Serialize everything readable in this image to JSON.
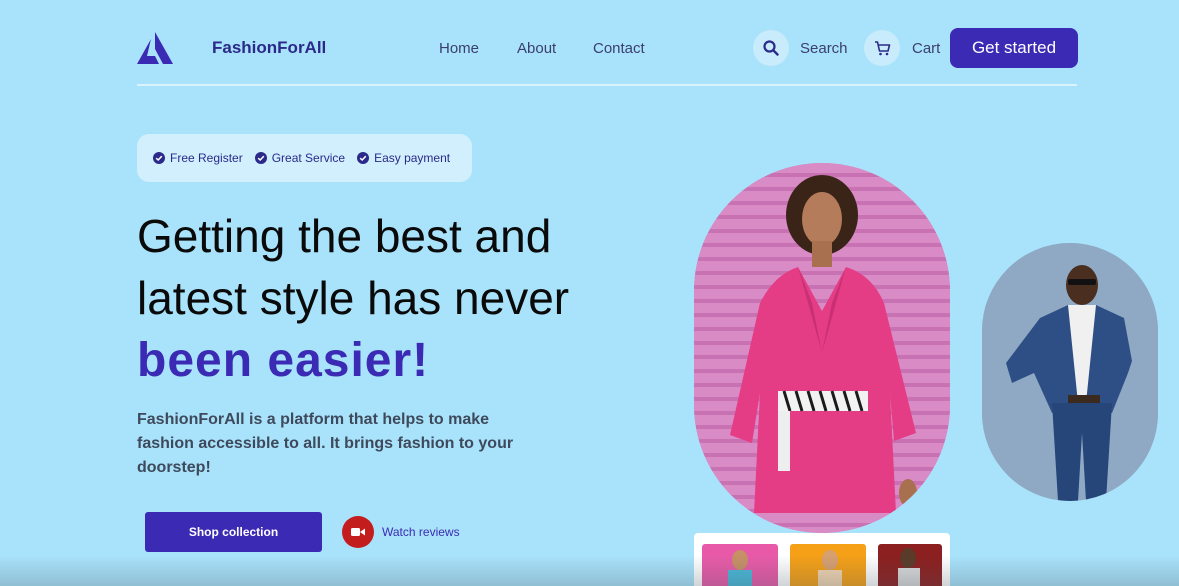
{
  "header": {
    "brand": "FashionForAll",
    "nav": [
      "Home",
      "About",
      "Contact"
    ],
    "search_label": "Search",
    "cart_label": "Cart",
    "cta_label": "Get started"
  },
  "hero": {
    "badges": [
      "Free Register",
      "Great Service",
      "Easy payment"
    ],
    "headline_line1": "Getting the best and",
    "headline_line2": "latest style has never",
    "headline_accent": "been easier!",
    "description": "FashionForAll is a platform that helps to make fashion accessible to all. It brings fashion to your doorstep!",
    "shop_button": "Shop collection",
    "watch_link": "Watch reviews"
  },
  "icons": {
    "logo": "logo-icon",
    "search": "search-icon",
    "cart": "cart-icon",
    "check": "check-circle-icon",
    "video": "video-camera-icon"
  },
  "colors": {
    "background": "#a9e3fb",
    "accent": "#3b2bb4",
    "brand_text": "#2b2a8a",
    "video_red": "#c41d1d"
  }
}
